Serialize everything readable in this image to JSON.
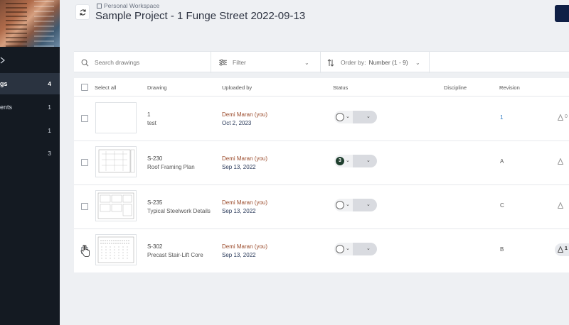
{
  "sidebar": {
    "items": [
      {
        "label": "gs",
        "count": "4",
        "active": true
      },
      {
        "label": "ents",
        "count": "1"
      },
      {
        "label": "",
        "count": "1"
      },
      {
        "label": "",
        "count": "3"
      }
    ]
  },
  "header": {
    "workspace": "Personal Workspace",
    "title": "Sample Project - 1 Funge Street 2022-09-13"
  },
  "toolbar": {
    "search_placeholder": "Search drawings",
    "filter_label": "Filter",
    "order_label": "Order by:",
    "order_value": "Number (1 - 9)"
  },
  "table": {
    "columns": {
      "select_all": "Select all",
      "drawing": "Drawing",
      "uploaded_by": "Uploaded by",
      "status": "Status",
      "discipline": "Discipline",
      "revision": "Revision"
    },
    "rows": [
      {
        "number": "1",
        "name": "test",
        "uploader": "Demi Maran (you)",
        "date": "Oct 2, 2023",
        "status_badge": "",
        "revision": "1",
        "revision_link": true,
        "side_count": "0"
      },
      {
        "number": "S-230",
        "name": "Roof Framing Plan",
        "uploader": "Demi Maran (you)",
        "date": "Sep 13, 2022",
        "status_badge": "3",
        "revision": "A",
        "side_count": ""
      },
      {
        "number": "S-235",
        "name": "Typical Steelwork Details",
        "uploader": "Demi Maran (you)",
        "date": "Sep 13, 2022",
        "status_badge": "",
        "revision": "C",
        "side_count": ""
      },
      {
        "number": "S-302",
        "name": "Precast Stair-Lift Core",
        "uploader": "Demi Maran (you)",
        "date": "Sep 13, 2022",
        "status_badge": "",
        "revision": "B",
        "side_count": "1"
      }
    ]
  },
  "colors": {
    "sidebar_bg": "#141a22",
    "link": "#2a78c2",
    "uploader": "#9a4a2a",
    "status_filled": "#1f3f2e"
  }
}
